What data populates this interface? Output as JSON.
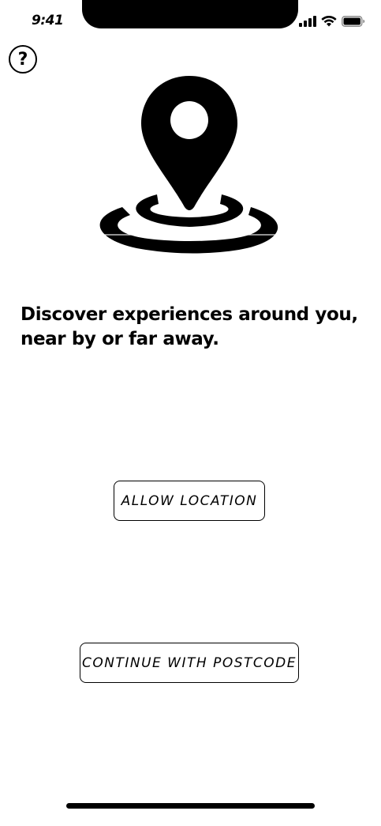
{
  "status_bar": {
    "time": "9:41",
    "icons": [
      "signal-icon",
      "wifi-icon",
      "battery-icon"
    ]
  },
  "help": {
    "label": "?",
    "icon": "help-icon"
  },
  "hero": {
    "icon": "location-pin-icon"
  },
  "headline": "Discover experiences around you, near by or far away.",
  "actions": {
    "allow_location": "ALLOW LOCATION",
    "continue_postcode": "CONTINUE WITH POSTCODE"
  }
}
